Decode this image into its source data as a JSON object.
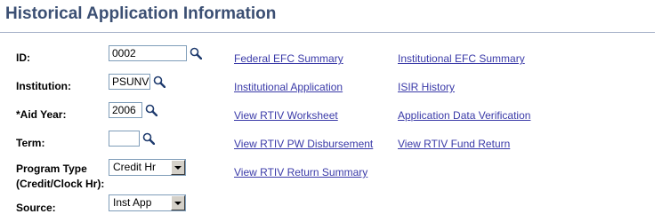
{
  "page": {
    "title": "Historical Application Information"
  },
  "form": {
    "id_label": "ID:",
    "id_value": "0002",
    "institution_label": "Institution:",
    "institution_value": "PSUNV",
    "aid_year_label": "*Aid Year:",
    "aid_year_value": "2006",
    "term_label": "Term:",
    "term_value": "",
    "program_type_label_line1": "Program Type",
    "program_type_label_line2": "(Credit/Clock Hr):",
    "program_type_value": "Credit Hr",
    "source_label": "Source:",
    "source_value": "Inst App"
  },
  "links": {
    "federal_efc_summary": "Federal EFC Summary",
    "institutional_efc_summary": "Institutional EFC Summary",
    "institutional_application": "Institutional Application",
    "isir_history": "ISIR History",
    "view_rtiv_worksheet": "View RTIV Worksheet",
    "application_data_verification": "Application Data Verification",
    "view_rtiv_pw_disbursement": "View RTIV PW Disbursement",
    "view_rtiv_fund_return": "View RTIV Fund Return",
    "view_rtiv_return_summary": "View RTIV Return Summary"
  },
  "icons": {
    "lookup": "magnifier-icon",
    "dropdown": "chevron-down-icon"
  },
  "colors": {
    "title": "#3b4f73",
    "link": "#3a3aa8",
    "rule": "#a6b1c9"
  }
}
